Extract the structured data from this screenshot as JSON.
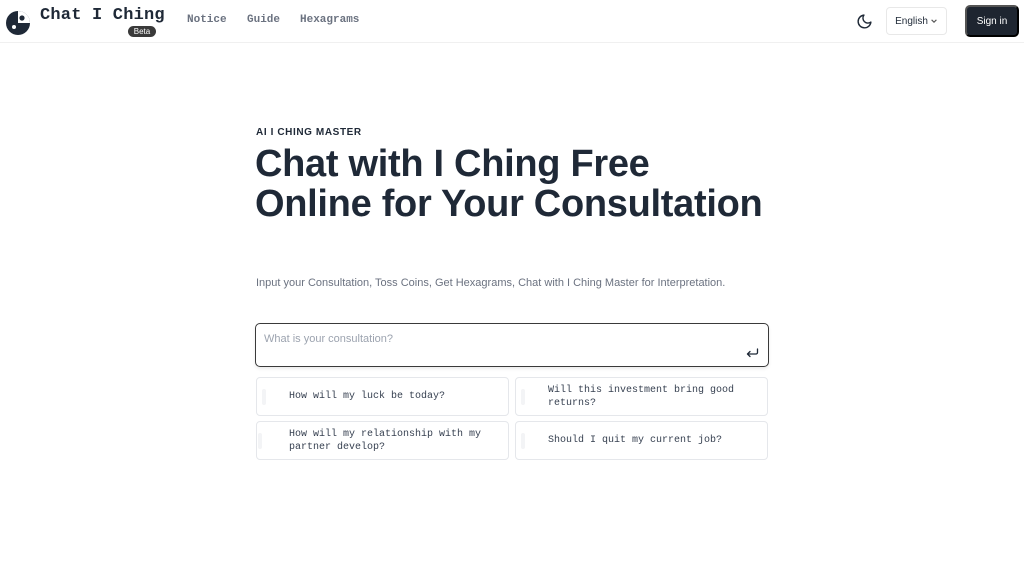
{
  "header": {
    "brand": "Chat I Ching",
    "badge": "Beta",
    "nav": [
      "Notice",
      "Guide",
      "Hexagrams"
    ],
    "language": "English",
    "signin_label": "Sign in",
    "icons": {
      "logo": "yin-yang-logo-icon",
      "theme": "moon-icon",
      "language_caret": "chevron-down-icon"
    }
  },
  "hero": {
    "eyebrow": "AI I CHING MASTER",
    "title": "Chat with I Ching Free Online for Your Consultation",
    "subtitle": "Input your Consultation, Toss Coins, Get Hexagrams, Chat with I Ching Master for Interpretation."
  },
  "consult": {
    "value": "",
    "placeholder": "What is your consultation?",
    "submit_icon": "enter-return-icon"
  },
  "suggestions": [
    {
      "emoji": "",
      "text": "How will my luck be today?"
    },
    {
      "emoji": "",
      "text": "Will this investment bring good returns?"
    },
    {
      "emoji": "",
      "text": "How will my relationship with my partner develop?"
    },
    {
      "emoji": "",
      "text": "Should I quit my current job?"
    }
  ],
  "colors": {
    "primary_button": "#1e2530",
    "text": "#1f2937",
    "muted": "#6b7280",
    "border": "#e5e7eb"
  }
}
